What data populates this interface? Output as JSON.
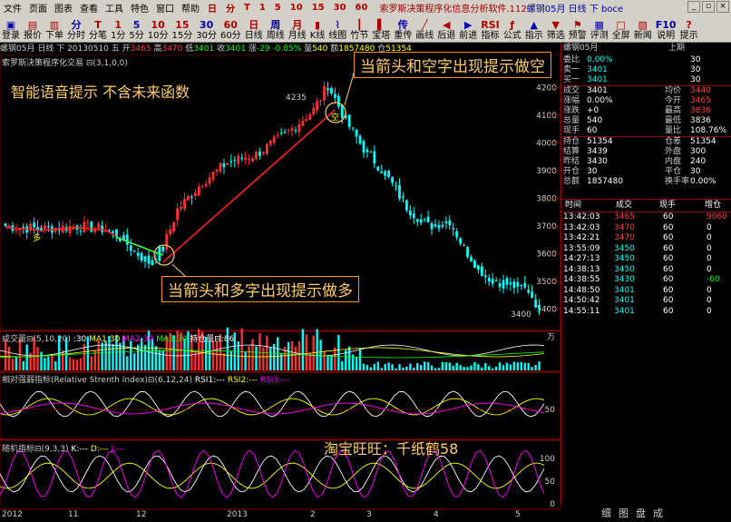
{
  "menu": {
    "items": [
      "文件",
      "页面",
      "图表",
      "查看",
      "工具",
      "特色",
      "窗口",
      "帮助"
    ],
    "timeframes": [
      "日",
      "分",
      "T",
      "1",
      "5",
      "10",
      "15",
      "30",
      "60"
    ],
    "title_main": "索罗斯决策程序化信息分析软件.112",
    "title_contract": "螺钢05月",
    "title_period": "日线",
    "title_sub": "下",
    "title_user": "boce"
  },
  "toolbar": {
    "buttons": [
      {
        "label": "登录",
        "icon": "▣"
      },
      {
        "label": "报价",
        "icon": "▤"
      },
      {
        "label": "下单",
        "icon": "▥"
      },
      {
        "label": "分时",
        "icon": "分"
      },
      {
        "label": "分笔",
        "icon": "T"
      },
      {
        "label": "1分",
        "icon": "1"
      },
      {
        "label": "5分",
        "icon": "5"
      },
      {
        "label": "10分",
        "icon": "10"
      },
      {
        "label": "15分",
        "icon": "15"
      },
      {
        "label": "30分",
        "icon": "30"
      },
      {
        "label": "60分",
        "icon": "60"
      },
      {
        "label": "日线",
        "icon": "日"
      },
      {
        "label": "周线",
        "icon": "周"
      },
      {
        "label": "月线",
        "icon": "月"
      },
      {
        "label": "K线",
        "icon": "▮"
      },
      {
        "label": "线图",
        "icon": "⌇"
      },
      {
        "label": "竹节",
        "icon": "┃"
      },
      {
        "label": "宝塔",
        "icon": "▌"
      },
      {
        "label": "重传",
        "icon": "传"
      },
      {
        "label": "画线",
        "icon": "╱"
      },
      {
        "label": "后退",
        "icon": "◀"
      },
      {
        "label": "前进",
        "icon": "▶"
      },
      {
        "label": "指标",
        "icon": "RSI"
      },
      {
        "label": "公式",
        "icon": "ƒ"
      },
      {
        "label": "指示",
        "icon": "▲"
      },
      {
        "label": "筛选",
        "icon": "▼"
      },
      {
        "label": "预警",
        "icon": "⚑"
      },
      {
        "label": "评测",
        "icon": "▦"
      },
      {
        "label": "全屏",
        "icon": "□"
      },
      {
        "label": "新闻",
        "icon": "▧"
      },
      {
        "label": "说明",
        "icon": "F10"
      },
      {
        "label": "提示",
        "icon": "?"
      }
    ]
  },
  "chart_header": {
    "contract": "螺钢05月",
    "period": "日线",
    "date": "下 20130510",
    "weekday": "五",
    "open_label": "开",
    "open": "3465",
    "high_label": "高",
    "high": "3470",
    "low_label": "低",
    "low": "3401",
    "close_label": "收",
    "close": "3401",
    "change_label": "涨",
    "change": "-29",
    "change_pct": "-0.85%",
    "volume_label": "量",
    "volume": "540",
    "amount_label": "额",
    "amount": "1857480",
    "oi_label": "仓",
    "oi": "51354"
  },
  "indicator_name": "索罗斯决策程序化交易 ⊟(3,1,0,0)",
  "price_labels": {
    "peak": "4235",
    "trough": "3400"
  },
  "price_axis": [
    "4200",
    "4100",
    "4000",
    "3900",
    "3800",
    "3700",
    "3600",
    "3500",
    "3400"
  ],
  "annotations": {
    "top": "当箭头和空字出现提示做空",
    "bottom": "当箭头和多字出现提示做多",
    "voice": "智能语音提示 不含未来函数",
    "taobao": "淘宝旺旺：千纸鹤58",
    "short_marker": "空",
    "long_marker": "多"
  },
  "volume_pane": {
    "title": "成交量⊟(5,10,20)",
    "v": ":30",
    "ma1": "MA1:30",
    "ma2": "MA2:30",
    "ma3": "MA3:30",
    "oi": "持仓量⊟:86",
    "unit": "万"
  },
  "rsi_pane": {
    "title": "相对强弱指标(Relative Strenth Index)⊟(6,12,24)",
    "rsi1": "RSI1:---",
    "rsi2": "RSI2:---",
    "rsi3": "RSI3:---",
    "axis": [
      "50"
    ]
  },
  "kdj_pane": {
    "title": "随机指标⊟(9,3,3)",
    "k": "K:---",
    "d": "D:---",
    "j": "J:---",
    "axis": [
      "100",
      "50",
      "0"
    ]
  },
  "dates": [
    "2012",
    "11",
    "12",
    "2013",
    "2",
    "3",
    "4",
    "5"
  ],
  "quote_panel": {
    "header_contract": "螺钢05月",
    "header_right": "上期",
    "rows": [
      {
        "l1": "委比",
        "v1": "0.00%",
        "l2": "",
        "v2": "30"
      },
      {
        "l1": "卖一",
        "v1": "3401",
        "l2": "",
        "v2": "30"
      },
      {
        "l1": "买一",
        "v1": "3401",
        "l2": "",
        "v2": "30"
      },
      {
        "l1": "成交",
        "v1": "3401",
        "l2": "均价",
        "v2": "3440"
      },
      {
        "l1": "涨幅",
        "v1": "0.00%",
        "l2": "今开",
        "v2": "3465"
      },
      {
        "l1": "涨跌",
        "v1": "+0",
        "l2": "最高",
        "v2": "3836"
      },
      {
        "l1": "总量",
        "v1": "540",
        "l2": "最低",
        "v2": "3836"
      },
      {
        "l1": "现手",
        "v1": "60",
        "l2": "量比",
        "v2": "108.76%"
      },
      {
        "l1": "持仓",
        "v1": "51354",
        "l2": "仓差",
        "v2": "51354"
      },
      {
        "l1": "结算",
        "v1": "3439",
        "l2": "外盘",
        "v2": "300"
      },
      {
        "l1": "昨结",
        "v1": "3430",
        "l2": "内盘",
        "v2": "240"
      },
      {
        "l1": "开仓",
        "v1": "30",
        "l2": "平仓",
        "v2": "30"
      },
      {
        "l1": "总额",
        "v1": "1857480",
        "l2": "换手率",
        "v2": "0.00%"
      }
    ]
  },
  "ticks": {
    "headers": [
      "时间",
      "成交",
      "现手",
      "增仓"
    ],
    "rows": [
      {
        "time": "13:42:03",
        "price": "3465",
        "vol": "60",
        "oi": "9060"
      },
      {
        "time": "13:42:03",
        "price": "3470",
        "vol": "60",
        "oi": "0"
      },
      {
        "time": "13:42:21",
        "price": "3470",
        "vol": "60",
        "oi": "0"
      },
      {
        "time": "13:55:09",
        "price": "3450",
        "vol": "60",
        "oi": "0"
      },
      {
        "time": "14:27:13",
        "price": "3450",
        "vol": "60",
        "oi": "0"
      },
      {
        "time": "14:38:13",
        "price": "3450",
        "vol": "60",
        "oi": "0"
      },
      {
        "time": "14:38:55",
        "price": "3430",
        "vol": "60",
        "oi": "-60"
      },
      {
        "time": "14:48:50",
        "price": "3401",
        "vol": "60",
        "oi": "0"
      },
      {
        "time": "14:50:42",
        "price": "3401",
        "vol": "60",
        "oi": "0"
      },
      {
        "time": "14:55:11",
        "price": "3401",
        "vol": "60",
        "oi": "0"
      }
    ]
  },
  "bottom_tabs": [
    "细",
    "图",
    "盘",
    "成"
  ]
}
